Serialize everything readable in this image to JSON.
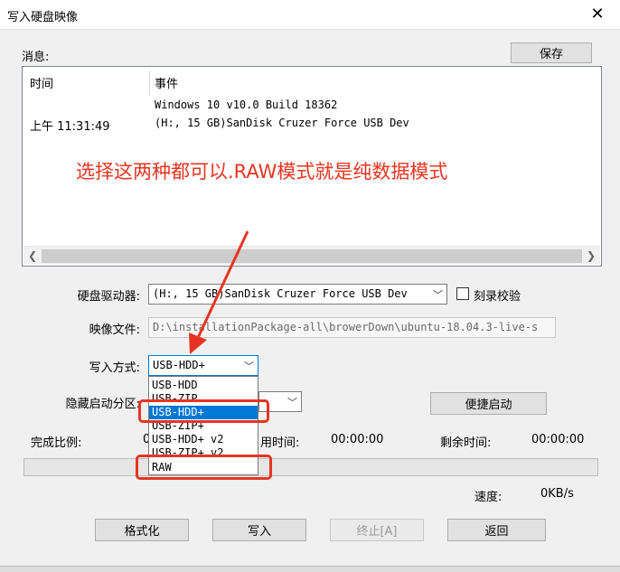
{
  "window": {
    "title": "写入硬盘映像",
    "close_icon": "close-icon"
  },
  "messages": {
    "label": "消息:",
    "save_button": "保存",
    "col_time": "时间",
    "col_event": "事件",
    "rows": [
      {
        "time": "",
        "event": "Windows 10 v10.0 Build 18362"
      },
      {
        "time": "上午 11:31:49",
        "event": "(H:, 15 GB)SanDisk Cruzer Force USB Dev"
      }
    ]
  },
  "annotation": {
    "text": "选择这两种都可以.RAW模式就是纯数据模式",
    "color": "#e53522"
  },
  "form": {
    "drive_label": "硬盘驱动器:",
    "drive_value": "(H:, 15 GB)SanDisk Cruzer Force USB Dev",
    "verify_label": "刻录校验",
    "image_label": "映像文件:",
    "image_value": "D:\\installationPackage-all\\browerDown\\ubuntu-18.04.3-live-s",
    "write_mode_label": "写入方式:",
    "write_mode_value": "USB-HDD+",
    "write_mode_options": [
      "USB-HDD",
      "USB-ZIP",
      "USB-HDD+",
      "USB-ZIP+",
      "USB-HDD+ v2",
      "USB-ZIP+ v2",
      "RAW"
    ],
    "selected_index": 2,
    "hidden_partition_label": "隐藏启动分区:",
    "quick_boot_button": "便捷启动"
  },
  "status": {
    "progress_label": "完成比例:",
    "progress_value_partial": "0",
    "elapsed_label_partial": "用时间:",
    "elapsed_value": "00:00:00",
    "remaining_label": "剩余时间:",
    "remaining_value": "00:00:00",
    "speed_label": "速度:",
    "speed_value": "0KB/s",
    "progress": 0
  },
  "buttons": {
    "format": "格式化",
    "write": "写入",
    "abort": "终止[A]",
    "back": "返回"
  },
  "colors": {
    "accent": "#0078d7",
    "annotation_red": "#e53522"
  }
}
